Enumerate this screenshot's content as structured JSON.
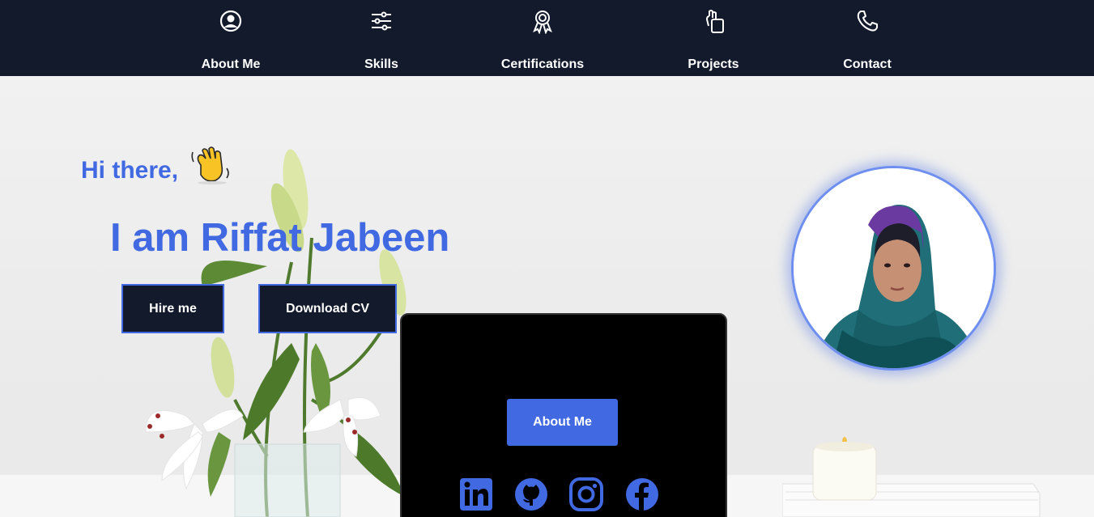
{
  "nav": {
    "items": [
      {
        "label": "About Me",
        "icon": "user-circle-icon"
      },
      {
        "label": "Skills",
        "icon": "sliders-icon"
      },
      {
        "label": "Certifications",
        "icon": "award-ribbon-icon"
      },
      {
        "label": "Projects",
        "icon": "hand-document-icon"
      },
      {
        "label": "Contact",
        "icon": "phone-icon"
      }
    ]
  },
  "hero": {
    "greeting": "Hi there,",
    "greeting_emoji": "waving-hand-icon",
    "headline": "I am Riffat Jabeen",
    "hire_label": "Hire me",
    "cv_label": "Download CV",
    "about_label": "About Me",
    "social": [
      {
        "name": "linkedin-icon"
      },
      {
        "name": "github-icon"
      },
      {
        "name": "instagram-icon"
      },
      {
        "name": "facebook-icon"
      }
    ]
  },
  "colors": {
    "navbar": "#121a2c",
    "accent": "#4169e1",
    "text_light": "#ffffff",
    "laptop": "#000000"
  }
}
